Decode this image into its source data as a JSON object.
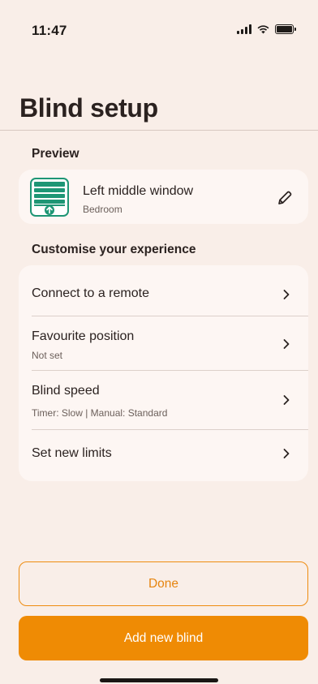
{
  "status_bar": {
    "time": "11:47",
    "icons": [
      "signal-icon",
      "wifi-icon",
      "battery-icon"
    ]
  },
  "page": {
    "title": "Blind setup"
  },
  "preview": {
    "heading": "Preview",
    "blind_name": "Left middle window",
    "room": "Bedroom",
    "icon": "roller-blind-icon",
    "edit_icon": "pencil-icon"
  },
  "settings": {
    "heading": "Customise your experience",
    "items": [
      {
        "label": "Connect to a remote",
        "sub": ""
      },
      {
        "label": "Favourite position",
        "sub": "Not set"
      },
      {
        "label": "Blind speed",
        "sub": "Timer: Slow | Manual: Standard"
      },
      {
        "label": "Set new limits",
        "sub": ""
      }
    ]
  },
  "actions": {
    "done_label": "Done",
    "add_label": "Add new blind"
  },
  "colors": {
    "background": "#f9eee8",
    "card": "#fdf6f3",
    "accent": "#ef8b04",
    "brand_green": "#1e9675"
  }
}
